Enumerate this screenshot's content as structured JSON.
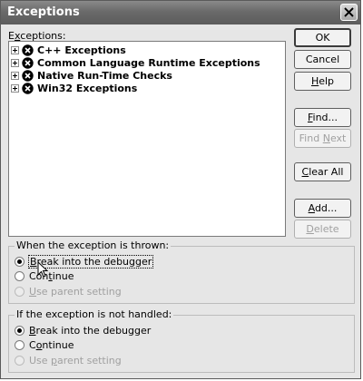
{
  "window": {
    "title": "Exceptions"
  },
  "exceptions_label": {
    "prefix": "E",
    "underlined": "x",
    "rest": "ceptions:"
  },
  "tree": [
    {
      "label": "C++ Exceptions"
    },
    {
      "label": "Common Language Runtime Exceptions"
    },
    {
      "label": "Native Run-Time Checks"
    },
    {
      "label": "Win32 Exceptions"
    }
  ],
  "buttons": {
    "ok": "OK",
    "cancel": "Cancel",
    "help": {
      "ul": "H",
      "rest": "elp"
    },
    "find": {
      "ul": "F",
      "rest": "ind..."
    },
    "find_next": {
      "pre": "Find ",
      "ul": "N",
      "rest": "ext"
    },
    "clear_all": {
      "ul": "C",
      "rest": "lear All"
    },
    "add": {
      "ul": "A",
      "rest": "dd..."
    },
    "delete": {
      "ul": "D",
      "rest": "elete"
    }
  },
  "thrown_group": {
    "title": "When the exception is thrown:",
    "break": {
      "ul": "B",
      "rest": "reak into the debugger"
    },
    "continue": {
      "pre": "Con",
      "ul": "t",
      "rest": "inue"
    },
    "parent": {
      "ul": "U",
      "rest": "se parent setting"
    }
  },
  "not_handled_group": {
    "title": "If the exception is not handled:",
    "break": {
      "ul": "B",
      "rest": "reak into the debugger"
    },
    "continue": {
      "pre": "C",
      "ul": "o",
      "rest": "ntinue"
    },
    "parent": {
      "pre": "Use ",
      "ul": "p",
      "rest": "arent setting"
    }
  },
  "icons": {
    "close": "close-icon",
    "exception": "x-circle-icon",
    "expander": "plus-box-icon",
    "cursor": "mouse-pointer-icon"
  }
}
